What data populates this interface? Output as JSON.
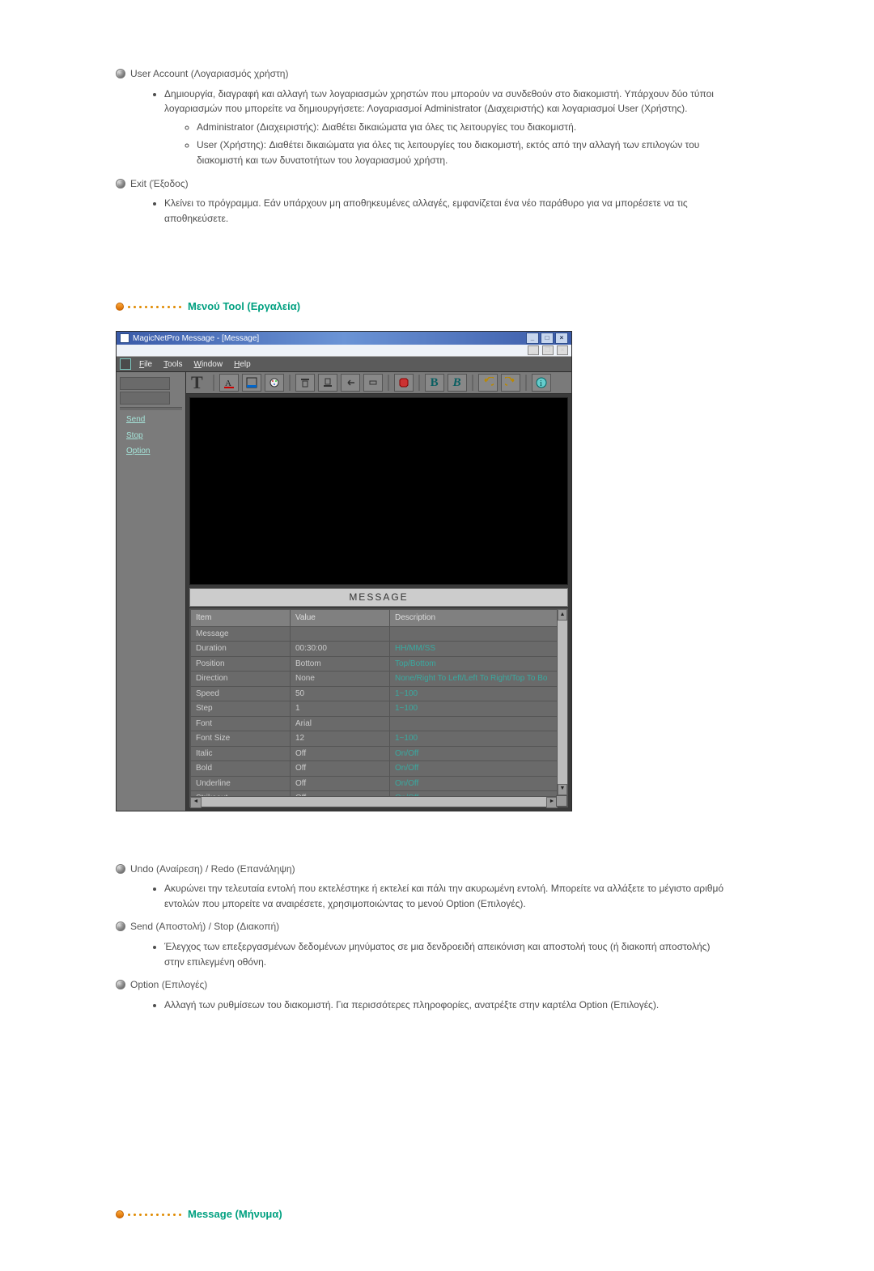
{
  "items": {
    "userAccount": {
      "title": "User Account (Λογαριασμός χρήστη)",
      "bullet1": "Δημιουργία, διαγραφή και αλλαγή των λογαριασμών χρηστών που μπορούν να συνδεθούν στο διακομιστή. Υπάρχουν δύο τύποι λογαριασμών που μπορείτε να δημιουργήσετε: Λογαριασμοί Administrator (Διαχειριστής) και λογαριασμοί User (Χρήστης).",
      "sub1": "Administrator (Διαχειριστής): Διαθέτει δικαιώματα για όλες τις λειτουργίες του διακομιστή.",
      "sub2": "User (Χρήστης): Διαθέτει δικαιώματα για όλες τις λειτουργίες του διακομιστή, εκτός από την αλλαγή των επιλογών του διακομιστή και των δυνατοτήτων του λογαριασμού χρήστη."
    },
    "exit": {
      "title": "Exit (Έξοδος)",
      "bullet1": "Κλείνει το πρόγραμμα. Εάν υπάρχουν μη αποθηκευμένες αλλαγές, εμφανίζεται ένα νέο παράθυρο για να μπορέσετε να τις αποθηκεύσετε."
    },
    "undo": {
      "title": "Undo (Αναίρεση) / Redo (Επανάληψη)",
      "bullet1": "Ακυρώνει την τελευταία εντολή που εκτελέστηκε ή εκτελεί και πάλι την ακυρωμένη εντολή. Μπορείτε να αλλάξετε το μέγιστο αριθμό εντολών που μπορείτε να αναιρέσετε, χρησιμοποιώντας το μενού Option (Επιλογές)."
    },
    "send": {
      "title": "Send (Αποστολή) / Stop (Διακοπή)",
      "bullet1": "Έλεγχος των επεξεργασμένων δεδομένων μηνύματος σε μια δενδροειδή απεικόνιση και αποστολή τους (ή διακοπή αποστολής) στην επιλεγμένη οθόνη."
    },
    "option": {
      "title": "Option (Επιλογές)",
      "bullet1": "Αλλαγή των ρυθμίσεων του διακομιστή. Για περισσότερες πληροφορίες, ανατρέξτε στην καρτέλα Option (Επιλογές)."
    }
  },
  "sections": {
    "toolMenu": "Μενού Tool (Εργαλεία)",
    "message": "Message (Μήνυμα)"
  },
  "screenshot": {
    "windowTitle": "MagicNetPro Message - [Message]",
    "menus": {
      "file": "File",
      "tools": "Tools",
      "window": "Window",
      "help": "Help"
    },
    "sidebar": {
      "topLabel": "",
      "send": "Send",
      "stop": "Stop",
      "option": "Option"
    },
    "canvasHeader": "MESSAGE",
    "grid": {
      "headers": {
        "item": "Item",
        "value": "Value",
        "description": "Description"
      },
      "rows": [
        {
          "item": "Message",
          "value": "",
          "desc": ""
        },
        {
          "item": "Duration",
          "value": "00:30:00",
          "desc": "HH/MM/SS"
        },
        {
          "item": "Position",
          "value": "Bottom",
          "desc": "Top/Bottom"
        },
        {
          "item": "Direction",
          "value": "None",
          "desc": "None/Right To Left/Left To Right/Top To Bo"
        },
        {
          "item": "Speed",
          "value": "50",
          "desc": "1~100"
        },
        {
          "item": "Step",
          "value": "1",
          "desc": "1~100"
        },
        {
          "item": "Font",
          "value": "Arial",
          "desc": ""
        },
        {
          "item": "Font Size",
          "value": "12",
          "desc": "1~100"
        },
        {
          "item": "Italic",
          "value": "Off",
          "desc": "On/Off"
        },
        {
          "item": "Bold",
          "value": "Off",
          "desc": "On/Off"
        },
        {
          "item": "Underline",
          "value": "Off",
          "desc": "On/Off"
        },
        {
          "item": "Strikeout",
          "value": "Off",
          "desc": "On/Off"
        }
      ]
    }
  }
}
